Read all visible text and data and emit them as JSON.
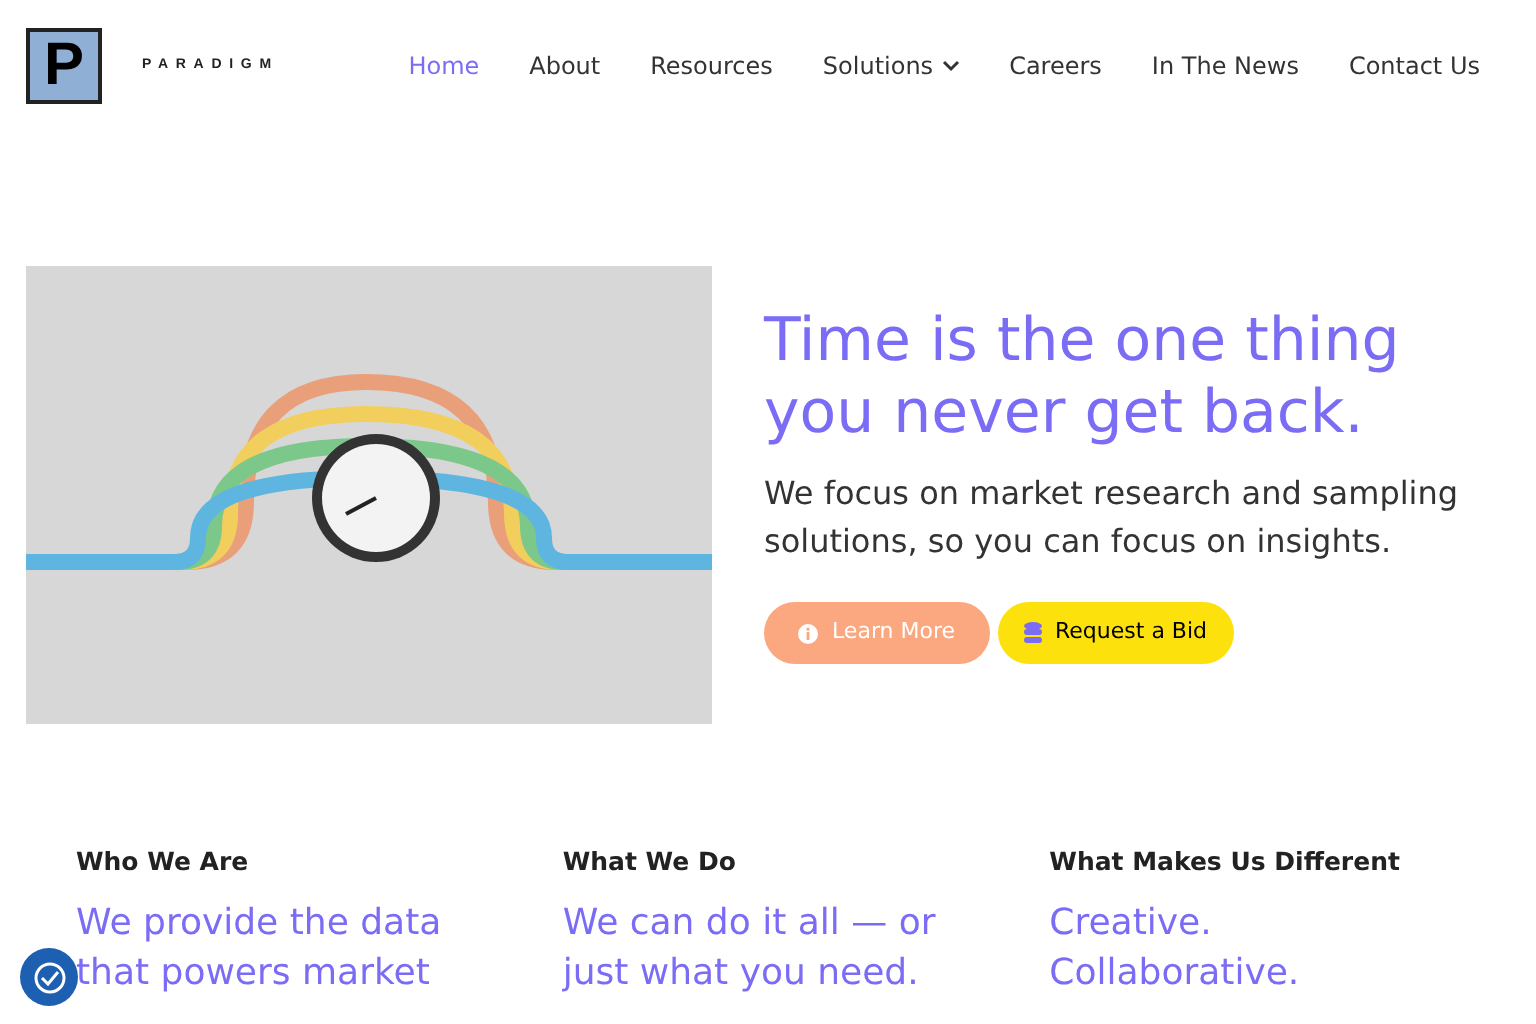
{
  "logo": {
    "letter": "P",
    "wordmark": "PARADIGM"
  },
  "nav": [
    {
      "label": "Home",
      "selected": true,
      "dropdown": false
    },
    {
      "label": "About",
      "selected": false,
      "dropdown": false
    },
    {
      "label": "Resources",
      "selected": false,
      "dropdown": false
    },
    {
      "label": "Solutions",
      "selected": false,
      "dropdown": true
    },
    {
      "label": "Careers",
      "selected": false,
      "dropdown": false
    },
    {
      "label": "In The News",
      "selected": false,
      "dropdown": false
    },
    {
      "label": "Contact Us",
      "selected": false,
      "dropdown": false
    }
  ],
  "hero": {
    "title": "Time is the one thing you never get back.",
    "subtitle": "We focus on market research and sampling solutions, so you can focus on insights.",
    "buttons": [
      {
        "label": "Learn More",
        "kind": "info"
      },
      {
        "label": "Request a Bid",
        "kind": "bid"
      }
    ]
  },
  "columns": [
    {
      "heading": "Who We Are",
      "text": "We provide the data that powers market"
    },
    {
      "heading": "What We Do",
      "text": "We can do it all — or just what you need."
    },
    {
      "heading": "What Makes Us Different",
      "text": "Creative. Collaborative."
    }
  ]
}
